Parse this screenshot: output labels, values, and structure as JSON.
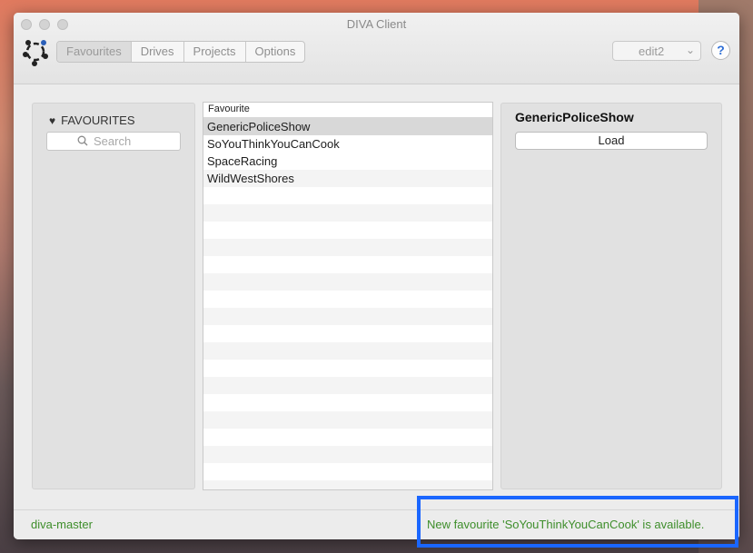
{
  "window": {
    "title": "DIVA Client"
  },
  "toolbar": {
    "tabs": [
      {
        "label": "Favourites",
        "active": true
      },
      {
        "label": "Drives",
        "active": false
      },
      {
        "label": "Projects",
        "active": false
      },
      {
        "label": "Options",
        "active": false
      }
    ],
    "site_select": "edit2",
    "help_label": "?"
  },
  "favourites": {
    "heading": "FAVOURITES",
    "search_placeholder": "Search",
    "icon": "heart-icon"
  },
  "list": {
    "column_header": "Favourite",
    "items": [
      "GenericPoliceShow",
      "SoYouThinkYouCanCook",
      "SpaceRacing",
      "WildWestShores"
    ],
    "selected_index": 0
  },
  "detail": {
    "title": "GenericPoliceShow",
    "load_label": "Load"
  },
  "status": {
    "server": "diva-master",
    "message": "New favourite 'SoYouThinkYouCanCook' is available."
  },
  "colors": {
    "status_text": "#3e8e2b",
    "highlight": "#1a66ff",
    "help_accent": "#2f6fd6"
  }
}
